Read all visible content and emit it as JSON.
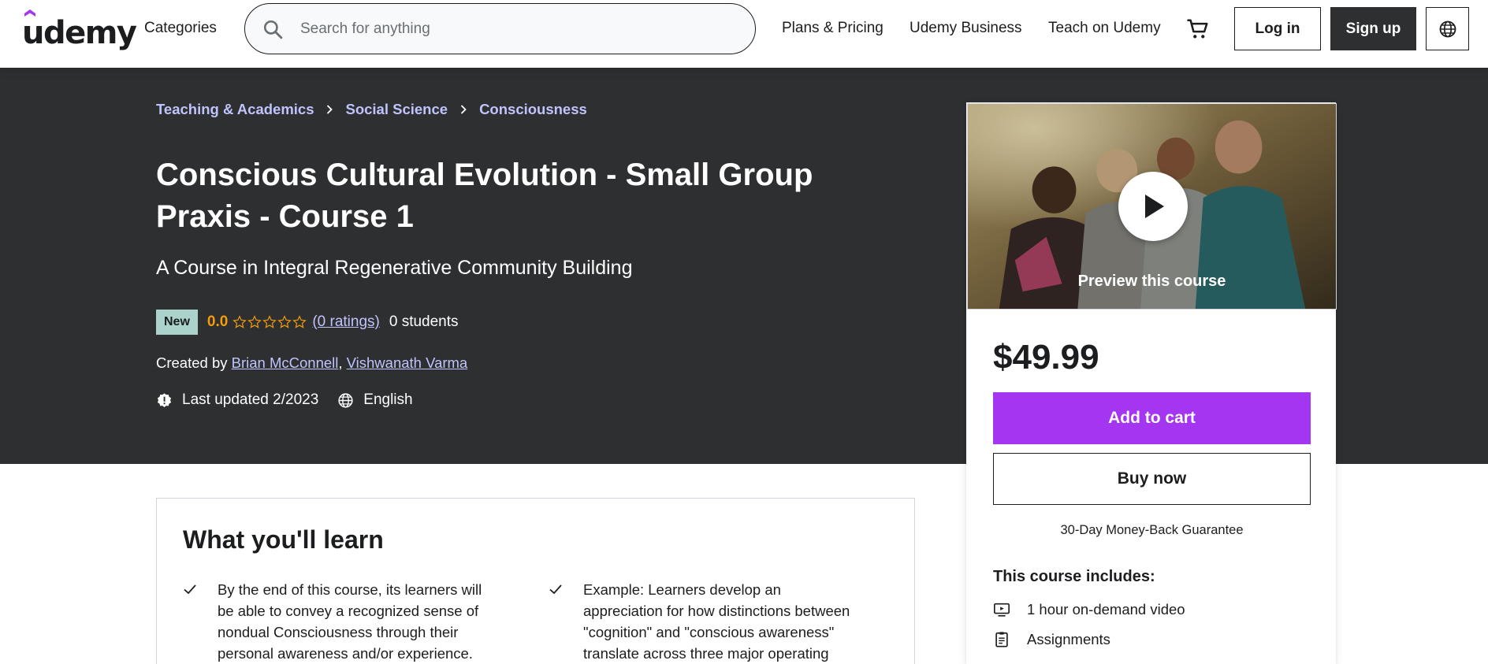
{
  "header": {
    "logo_text": "udemy",
    "categories_label": "Categories",
    "search_placeholder": "Search for anything",
    "nav_links": [
      "Plans & Pricing",
      "Udemy Business",
      "Teach on Udemy"
    ],
    "login_label": "Log in",
    "signup_label": "Sign up",
    "icons": [
      "search-icon",
      "cart-icon",
      "globe-icon"
    ]
  },
  "breadcrumb": [
    "Teaching & Academics",
    "Social Science",
    "Consciousness"
  ],
  "course": {
    "title": "Conscious Cultural Evolution - Small Group Praxis - Course 1",
    "subtitle": "A Course in Integral Regenerative Community Building",
    "badge": "New",
    "rating": "0.0",
    "stars_filled": 0,
    "stars_total": 5,
    "ratings_text": "(0 ratings)",
    "students_text": "0 students",
    "created_by_label": "Created by",
    "instructors": [
      "Brian McConnell",
      "Vishwanath Varma"
    ],
    "last_updated": "Last updated 2/2023",
    "language": "English"
  },
  "sidebar": {
    "preview_label": "Preview this course",
    "price": "$49.99",
    "add_to_cart_label": "Add to cart",
    "buy_now_label": "Buy now",
    "guarantee": "30-Day Money-Back Guarantee",
    "includes_title": "This course includes:",
    "includes": [
      {
        "icon": "video-icon",
        "label": "1 hour on-demand video"
      },
      {
        "icon": "assignment-icon",
        "label": "Assignments"
      }
    ]
  },
  "learn": {
    "title": "What you'll learn",
    "items": [
      "By the end of this course, its learners will be able to convey a recognized sense of nondual Consciousness through their personal awareness and/or experience.",
      "Example: Learners develop an appreciation for how distinctions between \"cognition\" and \"conscious awareness\" translate across three major operating systems."
    ]
  },
  "colors": {
    "accent": "#a435f0",
    "hero_bg": "#2d2f31",
    "link_light": "#c0c4fc",
    "rating": "#f69c08",
    "badge_new": "#acd2cc"
  }
}
